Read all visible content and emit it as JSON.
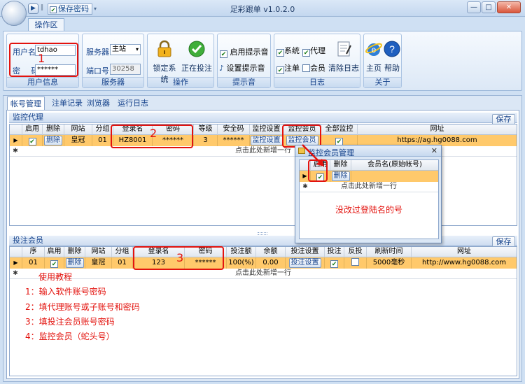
{
  "window": {
    "title": "足彩跟单 v1.0.2.0",
    "quick_save": "保存密码",
    "min": "—",
    "max": "□",
    "close": "✕"
  },
  "ribbon": {
    "tab": "操作区",
    "user": {
      "label_user": "用户名",
      "user_value": "tdhao",
      "label_pwd": "密 码",
      "pwd_value": "******",
      "group": "用户信息"
    },
    "server": {
      "label_server": "服务器",
      "server_value": "主站",
      "label_port": "端口号",
      "port_value": "30258",
      "group": "服务器"
    },
    "ops": {
      "lock": "锁定系统",
      "betting": "正在投注",
      "group": "操作"
    },
    "sound": {
      "enable": "启用提示音",
      "set": "设置提示音",
      "group": "提示音"
    },
    "log": {
      "system": "系统",
      "agent": "代理",
      "bet": "注单",
      "member": "会员",
      "clear": "清除日志",
      "group": "日志"
    },
    "about": {
      "home": "主页",
      "help": "帮助",
      "group": "关于"
    }
  },
  "tabs": [
    "帐号管理",
    "注单记录",
    "浏览器",
    "运行日志"
  ],
  "agent_panel": {
    "title": "监控代理",
    "save": "保存",
    "columns": [
      "启用",
      "删除",
      "网站",
      "分组",
      "登录名",
      "密码",
      "等级",
      "安全码",
      "监控设置",
      "监控会员",
      "全部监控",
      "网址"
    ],
    "row": {
      "site": "皇冠",
      "group": "01",
      "login": "HZ8001",
      "pwd": "******",
      "level": "3",
      "code": "******",
      "set_btn": "监控设置",
      "member_btn": "监控会员",
      "url": "https://ag.hg0088.com",
      "delete": "删除"
    },
    "new_row": "点击此处新增一行"
  },
  "bet_panel": {
    "title": "投注会员",
    "save": "保存",
    "columns": [
      "序",
      "启用",
      "删除",
      "网站",
      "分组",
      "登录名",
      "密码",
      "投注额",
      "余额",
      "投注设置",
      "投注",
      "反投",
      "刷新时间",
      "网址"
    ],
    "row": {
      "seq": "01",
      "delete": "删除",
      "site": "皇冠",
      "group": "01",
      "login": "123",
      "pwd": "******",
      "amount": "100(%)",
      "balance": "0.00",
      "set_btn": "投注设置",
      "refresh": "5000毫秒",
      "url": "http://www.hg0088.com"
    },
    "new_row": "点击此处新增一行"
  },
  "dialog": {
    "title": "监控会员管理",
    "columns": [
      "启用",
      "删除",
      "会员名(原始帐号)"
    ],
    "delete": "删除",
    "new_row": "点击此处新增一行",
    "note": "没改过登陆名的号",
    "close": "✕"
  },
  "instructions": {
    "title": "使用教程",
    "steps": [
      "1：输入软件账号密码",
      "2：填代理账号或子账号和密码",
      "3：填投注会员账号密码",
      "4：监控会员（蛇头号）"
    ]
  },
  "markers": {
    "m1": "1",
    "m2": "2",
    "m3": "3"
  },
  "icons": {
    "home": "ie-icon",
    "help": "help-icon",
    "lock": "lock-icon",
    "bet": "check-icon",
    "clear": "notepad-icon"
  }
}
